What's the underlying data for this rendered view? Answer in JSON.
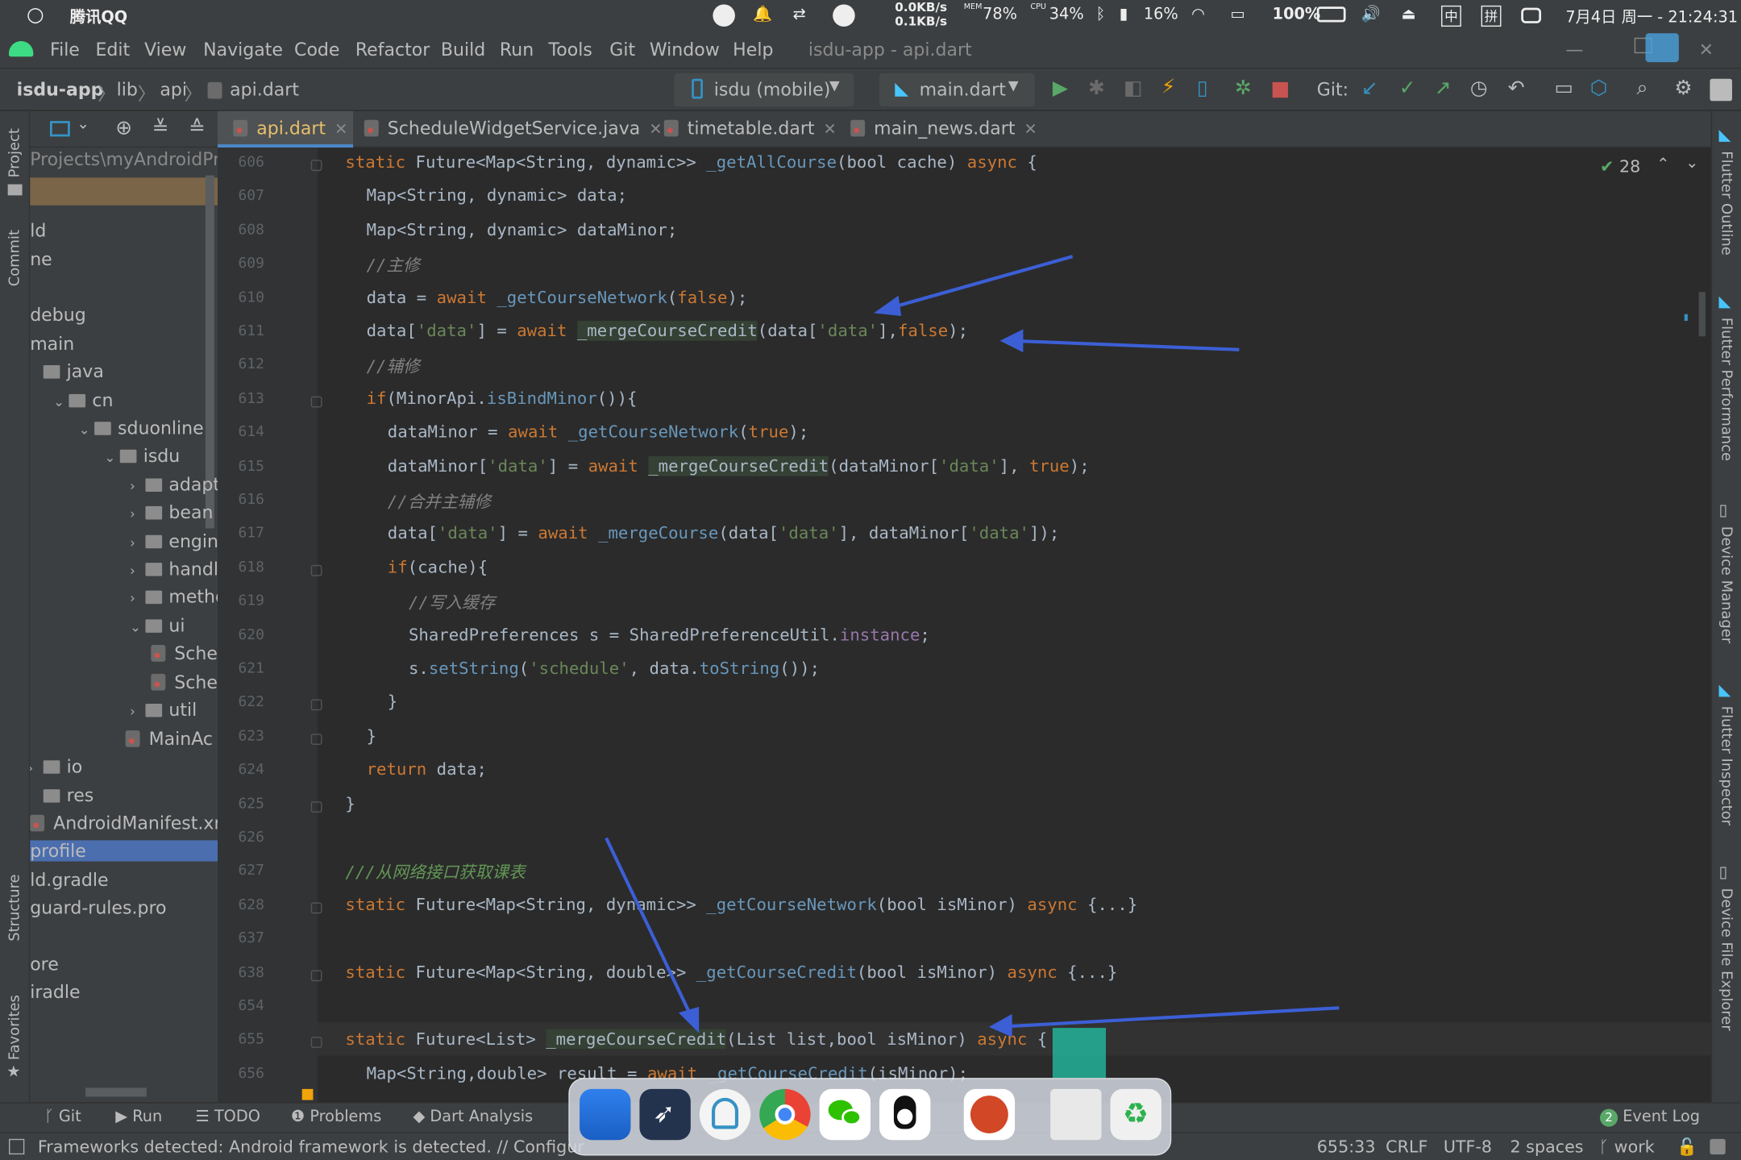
{
  "statusbar": {
    "app_name": "腾讯QQ",
    "net_up": "0.0KB/s",
    "net_down": "0.1KB/s",
    "mem_label": "MEM",
    "mem_value": "78%",
    "cpu_label": "CPU",
    "cpu_value": "34%",
    "bt_value": "16%",
    "battery_value": "100%",
    "datetime": "7月4日 周一 - 21:24:31",
    "ime1": "中",
    "ime2": "拼"
  },
  "menubar": {
    "items": [
      "File",
      "Edit",
      "View",
      "Navigate",
      "Code",
      "Refactor",
      "Build",
      "Run",
      "Tools",
      "Git",
      "Window",
      "Help"
    ],
    "window_title": "isdu-app - api.dart"
  },
  "navbar": {
    "breadcrumbs": [
      "isdu-app",
      "lib",
      "api",
      "api.dart"
    ],
    "device": "isdu (mobile)",
    "run_config": "main.dart",
    "git_label": "Git:"
  },
  "left_strip": {
    "project": "Project",
    "commit": "Commit",
    "structure": "Structure",
    "favorites": "Favorites"
  },
  "project": {
    "path": "Projects\\myAndroidPro",
    "items": [
      {
        "text": "ld",
        "indent": 0,
        "type": "text"
      },
      {
        "text": "ne",
        "indent": 0,
        "type": "text"
      },
      {
        "text": "debug",
        "indent": 0,
        "type": "text"
      },
      {
        "text": "main",
        "indent": 0,
        "type": "text"
      },
      {
        "text": "java",
        "indent": 0,
        "type": "folder",
        "chev": ""
      },
      {
        "text": "cn",
        "indent": 1,
        "type": "folder",
        "chev": "⌄"
      },
      {
        "text": "sduonline",
        "indent": 2,
        "type": "folder",
        "chev": "⌄"
      },
      {
        "text": "isdu",
        "indent": 3,
        "type": "folder",
        "chev": "⌄"
      },
      {
        "text": "adapter",
        "indent": 4,
        "type": "folder",
        "chev": "›"
      },
      {
        "text": "bean",
        "indent": 4,
        "type": "folder",
        "chev": "›"
      },
      {
        "text": "engine(",
        "indent": 4,
        "type": "folder",
        "chev": "›"
      },
      {
        "text": "handler",
        "indent": 4,
        "type": "folder",
        "chev": "›"
      },
      {
        "text": "method",
        "indent": 4,
        "type": "folder",
        "chev": "›"
      },
      {
        "text": "ui",
        "indent": 4,
        "type": "folder",
        "chev": "⌄"
      },
      {
        "text": "Sche",
        "indent": 5,
        "type": "file"
      },
      {
        "text": "Sche",
        "indent": 5,
        "type": "file"
      },
      {
        "text": "util",
        "indent": 4,
        "type": "folder",
        "chev": "›"
      },
      {
        "text": "MainAc",
        "indent": 4,
        "type": "file"
      },
      {
        "text": "io",
        "indent": 0,
        "type": "folder",
        "chev": "›"
      },
      {
        "text": "res",
        "indent": 0,
        "type": "folder",
        "chev": ""
      },
      {
        "text": "AndroidManifest.xm",
        "indent": 0,
        "type": "manifest"
      },
      {
        "text": "profile",
        "indent": 0,
        "type": "text"
      },
      {
        "text": "ld.gradle",
        "indent": 0,
        "type": "text"
      },
      {
        "text": "guard-rules.pro",
        "indent": 0,
        "type": "text"
      },
      {
        "text": "ore",
        "indent": 0,
        "type": "text"
      },
      {
        "text": "iradle",
        "indent": 0,
        "type": "text"
      }
    ]
  },
  "tabs": [
    {
      "label": "api.dart",
      "active": true
    },
    {
      "label": "ScheduleWidgetService.java",
      "active": false
    },
    {
      "label": "timetable.dart",
      "active": false
    },
    {
      "label": "main_news.dart",
      "active": false
    }
  ],
  "editor": {
    "check_count": "28",
    "lines": [
      {
        "n": "606",
        "segs": [
          [
            "kw",
            "static "
          ],
          [
            "ty",
            "Future<Map<String, dynamic>> "
          ],
          [
            "fn",
            "_getAllCourse"
          ],
          [
            "pu",
            "("
          ],
          [
            "ty",
            "bool "
          ],
          [
            "pu",
            "cache) "
          ],
          [
            "kw",
            "async "
          ],
          [
            "pu",
            "{"
          ]
        ],
        "ind": 0
      },
      {
        "n": "607",
        "segs": [
          [
            "ty",
            "Map<String, dynamic> "
          ],
          [
            "pu",
            "data;"
          ]
        ],
        "ind": 1
      },
      {
        "n": "608",
        "segs": [
          [
            "ty",
            "Map<String, dynamic> "
          ],
          [
            "pu",
            "dataMinor;"
          ]
        ],
        "ind": 1
      },
      {
        "n": "609",
        "segs": [
          [
            "gc",
            "//主修"
          ]
        ],
        "ind": 1
      },
      {
        "n": "610",
        "segs": [
          [
            "pu",
            "data = "
          ],
          [
            "kw",
            "await "
          ],
          [
            "fn",
            "_getCourseNetwork"
          ],
          [
            "pu",
            "("
          ],
          [
            "kw",
            "false"
          ],
          [
            "pu",
            ");"
          ]
        ],
        "ind": 1
      },
      {
        "n": "611",
        "segs": [
          [
            "pu",
            "data["
          ],
          [
            "st",
            "'data'"
          ],
          [
            "pu",
            "] = "
          ],
          [
            "kw",
            "await "
          ],
          [
            "hl",
            "_mergeCourseCredit"
          ],
          [
            "pu",
            "(data["
          ],
          [
            "st",
            "'data'"
          ],
          [
            "pu",
            "],"
          ],
          [
            "kw",
            "false"
          ],
          [
            "pu",
            ");"
          ]
        ],
        "ind": 1
      },
      {
        "n": "612",
        "segs": [
          [
            "gc",
            "//辅修"
          ]
        ],
        "ind": 1
      },
      {
        "n": "613",
        "segs": [
          [
            "kw",
            "if"
          ],
          [
            "pu",
            "(MinorApi."
          ],
          [
            "fn",
            "isBindMinor"
          ],
          [
            "pu",
            "()){"
          ]
        ],
        "ind": 1
      },
      {
        "n": "614",
        "segs": [
          [
            "pu",
            "dataMinor = "
          ],
          [
            "kw",
            "await "
          ],
          [
            "fn",
            "_getCourseNetwork"
          ],
          [
            "pu",
            "("
          ],
          [
            "kw",
            "true"
          ],
          [
            "pu",
            ");"
          ]
        ],
        "ind": 2
      },
      {
        "n": "615",
        "segs": [
          [
            "pu",
            "dataMinor["
          ],
          [
            "st",
            "'data'"
          ],
          [
            "pu",
            "] = "
          ],
          [
            "kw",
            "await "
          ],
          [
            "hl",
            "_mergeCourseCredit"
          ],
          [
            "pu",
            "(dataMinor["
          ],
          [
            "st",
            "'data'"
          ],
          [
            "pu",
            "], "
          ],
          [
            "kw",
            "true"
          ],
          [
            "pu",
            ");"
          ]
        ],
        "ind": 2
      },
      {
        "n": "616",
        "segs": [
          [
            "gc",
            "//合并主辅修"
          ]
        ],
        "ind": 2
      },
      {
        "n": "617",
        "segs": [
          [
            "pu",
            "data["
          ],
          [
            "st",
            "'data'"
          ],
          [
            "pu",
            "] = "
          ],
          [
            "kw",
            "await "
          ],
          [
            "fn",
            "_mergeCourse"
          ],
          [
            "pu",
            "(data["
          ],
          [
            "st",
            "'data'"
          ],
          [
            "pu",
            "], dataMinor["
          ],
          [
            "st",
            "'data'"
          ],
          [
            "pu",
            "]);"
          ]
        ],
        "ind": 2
      },
      {
        "n": "618",
        "segs": [
          [
            "kw",
            "if"
          ],
          [
            "pu",
            "(cache){"
          ]
        ],
        "ind": 2
      },
      {
        "n": "619",
        "segs": [
          [
            "gc",
            "//写入缓存"
          ]
        ],
        "ind": 3
      },
      {
        "n": "620",
        "segs": [
          [
            "ty",
            "SharedPreferences "
          ],
          [
            "pu",
            "s = SharedPreferenceUtil."
          ],
          [
            "ft",
            "instance"
          ],
          [
            "pu",
            ";"
          ]
        ],
        "ind": 3
      },
      {
        "n": "621",
        "segs": [
          [
            "pu",
            "s."
          ],
          [
            "fn",
            "setString"
          ],
          [
            "pu",
            "("
          ],
          [
            "st",
            "'schedule'"
          ],
          [
            "pu",
            ", data."
          ],
          [
            "fn",
            "toString"
          ],
          [
            "pu",
            "());"
          ]
        ],
        "ind": 3
      },
      {
        "n": "622",
        "segs": [
          [
            "pu",
            "}"
          ]
        ],
        "ind": 2
      },
      {
        "n": "623",
        "segs": [
          [
            "pu",
            "}"
          ]
        ],
        "ind": 1
      },
      {
        "n": "624",
        "segs": [
          [
            "kw",
            "return "
          ],
          [
            "pu",
            "data;"
          ]
        ],
        "ind": 1
      },
      {
        "n": "625",
        "segs": [
          [
            "pu",
            "}"
          ]
        ],
        "ind": 0
      },
      {
        "n": "626",
        "segs": [],
        "ind": 0
      },
      {
        "n": "627",
        "segs": [
          [
            "cm",
            "///从网络接口获取课表"
          ]
        ],
        "ind": 0
      },
      {
        "n": "628",
        "segs": [
          [
            "kw",
            "static "
          ],
          [
            "ty",
            "Future<Map<String, dynamic>> "
          ],
          [
            "fn",
            "_getCourseNetwork"
          ],
          [
            "pu",
            "("
          ],
          [
            "ty",
            "bool "
          ],
          [
            "pu",
            "isMinor) "
          ],
          [
            "kw",
            "async "
          ],
          [
            "pu",
            "{...}"
          ]
        ],
        "ind": 0
      },
      {
        "n": "637",
        "segs": [],
        "ind": 0
      },
      {
        "n": "638",
        "segs": [
          [
            "kw",
            "static "
          ],
          [
            "ty",
            "Future<Map<String, double>> "
          ],
          [
            "fn",
            "_getCourseCredit"
          ],
          [
            "pu",
            "("
          ],
          [
            "ty",
            "bool "
          ],
          [
            "pu",
            "isMinor) "
          ],
          [
            "kw",
            "async "
          ],
          [
            "pu",
            "{...}"
          ]
        ],
        "ind": 0
      },
      {
        "n": "654",
        "segs": [],
        "ind": 0
      },
      {
        "n": "655",
        "segs": [
          [
            "kw",
            "static "
          ],
          [
            "ty",
            "Future<List> "
          ],
          [
            "hl",
            "_mergeCourseCredit"
          ],
          [
            "pu",
            "("
          ],
          [
            "ty",
            "List "
          ],
          [
            "pu",
            "list,"
          ],
          [
            "ty",
            "bool "
          ],
          [
            "pu",
            "isMinor) "
          ],
          [
            "kw",
            "async "
          ],
          [
            "pu",
            "{"
          ]
        ],
        "ind": 0
      },
      {
        "n": "656",
        "segs": [
          [
            "ty",
            "Map<String,double> "
          ],
          [
            "pu",
            "result = "
          ],
          [
            "kw",
            "await "
          ],
          [
            "fn",
            "_getCourseCredit"
          ],
          [
            "pu",
            "(isMinor);"
          ]
        ],
        "ind": 1
      }
    ]
  },
  "right_strip": [
    "Flutter Outline",
    "Flutter Performance",
    "Device Manager",
    "Flutter Inspector",
    "Device File Explorer"
  ],
  "bottom_tools": {
    "git": "Git",
    "run": "Run",
    "todo": "TODO",
    "problems": "Problems",
    "dart": "Dart Analysis",
    "event_count": "2",
    "event_log": "Event Log"
  },
  "status": {
    "message": "Frameworks detected: Android framework is detected. // Configur",
    "position": "655:33",
    "line_sep": "CRLF",
    "encoding": "UTF-8",
    "indent": "2 spaces",
    "branch": "work"
  }
}
